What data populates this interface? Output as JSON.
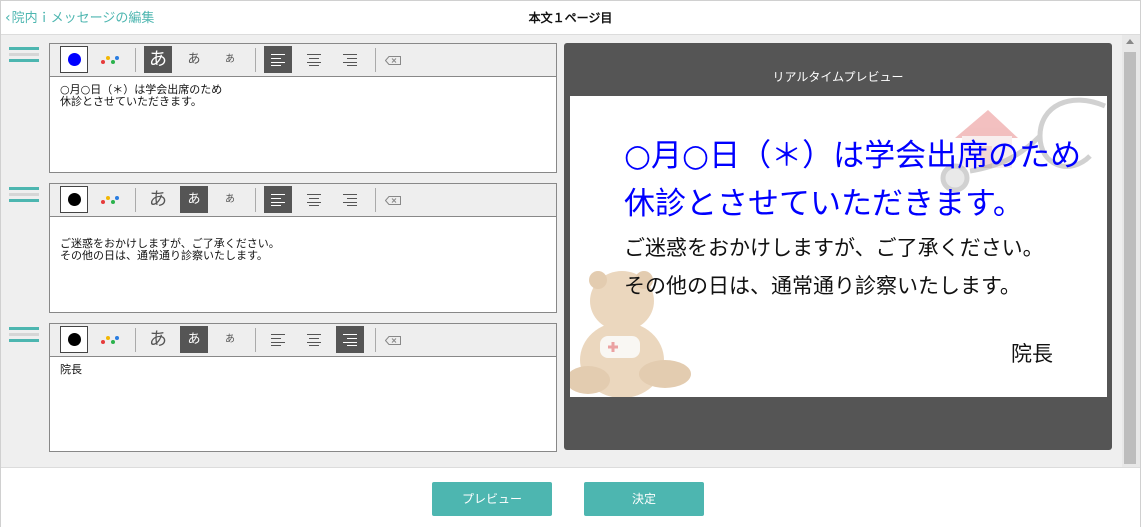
{
  "header": {
    "back_label": "院内ｉメッセージの編集",
    "title": "本文１ページ目"
  },
  "editors": [
    {
      "text": "○月○日（＊）は学会出席のため\n休診とさせていただきます。",
      "color": "#0000ff",
      "size": "large",
      "align": "left"
    },
    {
      "text": "ご迷惑をおかけしますが、ご了承ください。\nその他の日は、通常通り診察いたします。",
      "color": "#000000",
      "size": "medium",
      "align": "left"
    },
    {
      "text": "院長",
      "color": "#000000",
      "size": "medium",
      "align": "right"
    }
  ],
  "toolbar": {
    "size_large": "あ",
    "size_medium": "あ",
    "size_small": "あ"
  },
  "preview": {
    "title": "リアルタイムプレビュー",
    "line1": "○月○日（＊）は学会出席のため",
    "line2": "休診とさせていただきます。",
    "line3": "ご迷惑をおかけしますが、ご了承ください。",
    "line4": "その他の日は、通常通り診察いたします。",
    "line5": "院長"
  },
  "footer": {
    "preview_button": "プレビュー",
    "confirm_button": "決定"
  },
  "colors": {
    "accent": "#4db6b0",
    "blue": "#0000ff",
    "dark": "#555555"
  }
}
